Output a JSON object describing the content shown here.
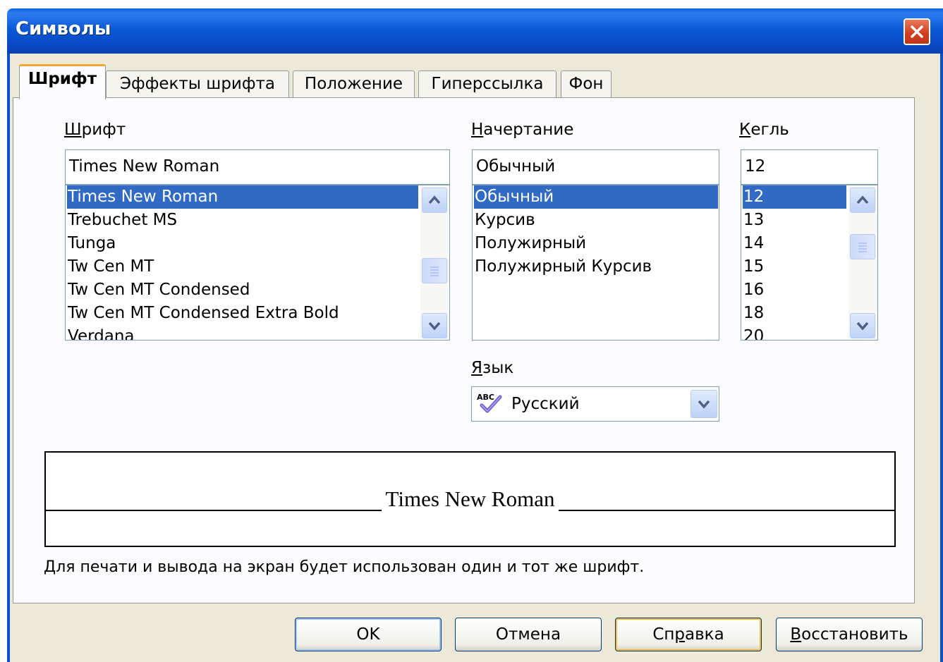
{
  "window": {
    "title": "Символы"
  },
  "tabs": [
    {
      "label": "Шрифт",
      "active": true
    },
    {
      "label": "Эффекты шрифта",
      "active": false
    },
    {
      "label": "Положение",
      "active": false
    },
    {
      "label": "Гиперссылка",
      "active": false
    },
    {
      "label": "Фон",
      "active": false
    }
  ],
  "font": {
    "label_accel": "Ш",
    "label_rest": "рифт",
    "value": "Times New Roman",
    "items": [
      "Times New Roman",
      "Trebuchet MS",
      "Tunga",
      "Tw Cen MT",
      "Tw Cen MT Condensed",
      "Tw Cen MT Condensed Extra Bold",
      "Verdana"
    ],
    "selected_index": 0
  },
  "style": {
    "label_accel": "Н",
    "label_rest": "ачертание",
    "value": "Обычный",
    "items": [
      "Обычный",
      "Курсив",
      "Полужирный",
      "Полужирный Курсив"
    ],
    "selected_index": 0
  },
  "size": {
    "label_accel": "К",
    "label_rest": "егль",
    "value": "12",
    "items": [
      "12",
      "13",
      "14",
      "15",
      "16",
      "18",
      "20"
    ],
    "selected_index": 0
  },
  "language": {
    "label_accel": "Я",
    "label_rest": "зык",
    "value": "Русский",
    "icon": "spellcheck-abc-icon"
  },
  "preview": {
    "text": "Times New Roman"
  },
  "note": "Для печати и вывода на экран будет использован один и тот же шрифт.",
  "buttons": {
    "ok": "OK",
    "cancel": "Отмена",
    "help_pre": "Сп",
    "help_accel": "р",
    "help_post": "авка",
    "reset_accel": "В",
    "reset_rest": "осстановить"
  },
  "colors": {
    "selection": "#316ac5",
    "titlebar": "#0a5fe0",
    "dialog_bg": "#ece9d8"
  }
}
